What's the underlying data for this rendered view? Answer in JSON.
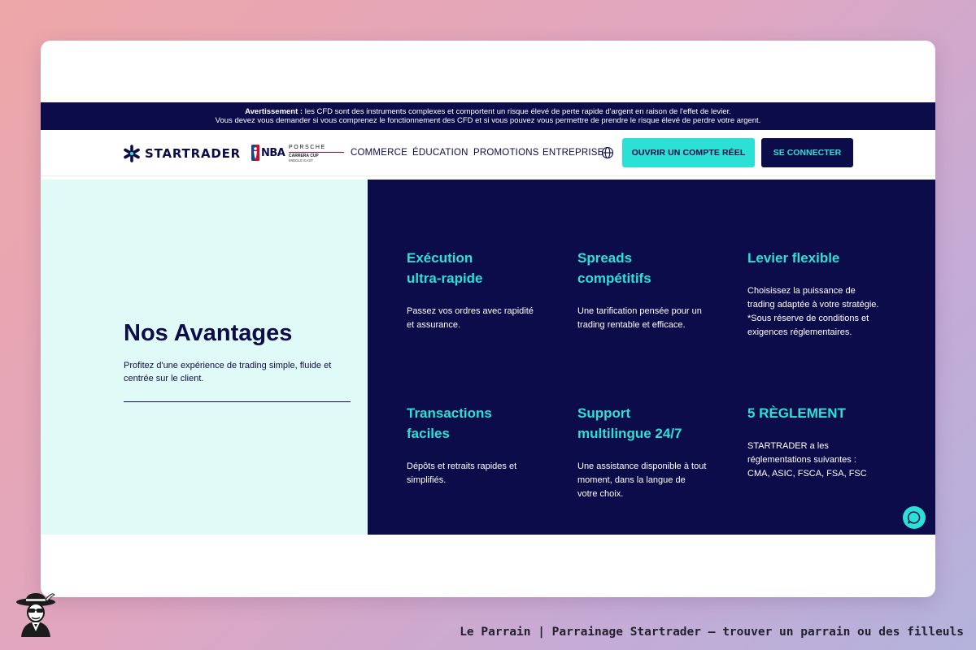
{
  "warning": {
    "label": "Avertissement :",
    "line1": " les CFD sont des instruments complexes et comportent un risque élevé de perte rapide d'argent en raison de l'effet de levier.",
    "line2": "Vous devez vous demander si vous comprenez le fonctionnement des CFD et si vous pouvez vous permettre de prendre le risque élevé de perdre votre argent."
  },
  "header": {
    "brand": "STARTRADER",
    "partners": {
      "nba": "NBA",
      "porsche": "PORSCHE",
      "porsche_sub1": "CARRERA CUP",
      "porsche_sub2": "MIDDLE EAST"
    },
    "nav": [
      "COMMERCE",
      "ÉDUCATION",
      "PROMOTIONS",
      "ENTREPRISE"
    ],
    "open_account": "OUVRIR UN COMPTE RÉEL",
    "login": "SE CONNECTER"
  },
  "hero": {
    "title": "Nos Avantages",
    "subtitle": "Profitez d'une expérience de trading simple, fluide et centrée sur le client."
  },
  "features": [
    {
      "title1": "Exécution",
      "title2": "ultra-rapide",
      "desc": "Passez vos ordres avec rapidité et assurance."
    },
    {
      "title1": "Spreads",
      "title2": "compétitifs",
      "desc": "Une tarification pensée pour un trading rentable et efficace."
    },
    {
      "title1": "Levier flexible",
      "title2": "",
      "desc": "Choisissez la puissance de trading adaptée à votre stratégie.",
      "note": "*Sous réserve de conditions et exigences réglementaires."
    },
    {
      "title1": "Transactions",
      "title2": "faciles",
      "desc": "Dépôts et retraits rapides et simplifiés."
    },
    {
      "title1": "Support",
      "title2": "multilingue 24/7",
      "desc": "Une assistance disponible à tout moment, dans la langue de votre choix."
    },
    {
      "title1": "5 RÈGLEMENT",
      "title2": "",
      "desc": "STARTRADER a les réglementations suivantes : CMA, ASIC, FSCA, FSA, FSC"
    }
  ],
  "icons": {
    "logo": "startrader-star-icon",
    "nba": "nba-logo-icon",
    "globe": "globe-icon",
    "chat": "chat-bubble-icon",
    "mascot": "godfather-mascot-icon"
  },
  "colors": {
    "navy": "#0d0c4a",
    "teal": "#2be0d5",
    "mint": "#e0faf7",
    "porsche_red": "#d5001c"
  },
  "caption": "Le Parrain | Parrainage Startrader — trouver un parrain ou des filleuls"
}
